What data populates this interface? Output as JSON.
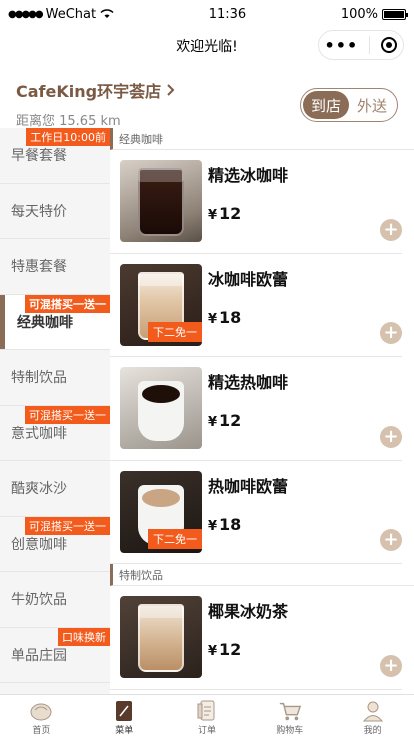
{
  "status_bar": {
    "carrier": "WeChat",
    "time": "11:36",
    "battery": "100%",
    "battery_level": 1.0
  },
  "nav": {
    "title": "欢迎光临!",
    "more_icon": "more-dots-icon",
    "close_icon": "target-circle-icon"
  },
  "store": {
    "name": "CafeKing环宇荟店",
    "distance": "距离您 15.65 km"
  },
  "mode_toggle": {
    "options": [
      "到店",
      "外送"
    ],
    "selected": "到店"
  },
  "sidebar": {
    "items": [
      {
        "label": "早餐套餐",
        "tag": "工作日10:00前"
      },
      {
        "label": "每天特价",
        "tag": ""
      },
      {
        "label": "特惠套餐",
        "tag": ""
      },
      {
        "label": "经典咖啡",
        "tag": "可混搭买一送一",
        "active": true
      },
      {
        "label": "特制饮品",
        "tag": ""
      },
      {
        "label": "意式咖啡",
        "tag": "可混搭买一送一"
      },
      {
        "label": "酷爽冰沙",
        "tag": ""
      },
      {
        "label": "创意咖啡",
        "tag": "可混搭买一送一"
      },
      {
        "label": "牛奶饮品",
        "tag": ""
      },
      {
        "label": "单品庄园",
        "tag": "口味换新"
      }
    ]
  },
  "sections": [
    {
      "title": "经典咖啡",
      "products": [
        {
          "name": "精选冰咖啡",
          "currency": "¥",
          "price": "12",
          "promo": ""
        },
        {
          "name": "冰咖啡欧蕾",
          "currency": "¥",
          "price": "18",
          "promo": "下二免一"
        },
        {
          "name": "精选热咖啡",
          "currency": "¥",
          "price": "12",
          "promo": ""
        },
        {
          "name": "热咖啡欧蕾",
          "currency": "¥",
          "price": "18",
          "promo": "下二免一"
        }
      ]
    },
    {
      "title": "特制饮品",
      "products": [
        {
          "name": "椰果冰奶茶",
          "currency": "¥",
          "price": "12",
          "promo": ""
        }
      ]
    }
  ],
  "tabbar": {
    "items": [
      {
        "label": "首页",
        "icon": "home-icon"
      },
      {
        "label": "菜单",
        "icon": "menu-icon",
        "active": true
      },
      {
        "label": "订单",
        "icon": "order-icon"
      },
      {
        "label": "购物车",
        "icon": "cart-icon"
      },
      {
        "label": "我的",
        "icon": "profile-icon"
      }
    ]
  },
  "colors": {
    "brand": "#8b6d57",
    "accent": "#f25b1b",
    "add_button": "#d5c1ad"
  }
}
